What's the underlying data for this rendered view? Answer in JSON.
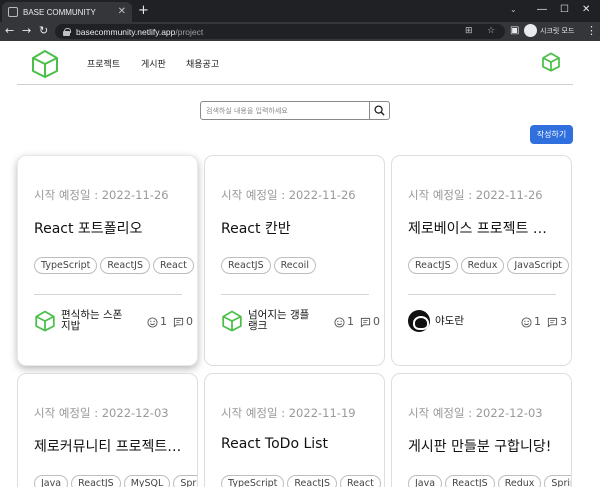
{
  "browser": {
    "tab_title": "BASE COMMUNITY",
    "url_host": "basecommunity.netlify.app",
    "url_path": "/project",
    "profile_label": "시크릿 모드"
  },
  "header": {
    "nav": [
      "프로젝트",
      "게시판",
      "채용공고"
    ]
  },
  "search": {
    "placeholder": "검색하실 내용을 입력하세요"
  },
  "write_button": "작성하기",
  "colors": {
    "accent": "#2f6fde",
    "logo_green": "#4cbf4a"
  },
  "cards": [
    {
      "date": "시작 예정일 : 2022-11-26",
      "title": "React 포트폴리오",
      "tags": [
        "TypeScript",
        "ReactJS",
        "React"
      ],
      "author": "편식하는 스폰지밥",
      "avatar": "cube-icon",
      "likes": "1",
      "comments": "0"
    },
    {
      "date": "시작 예정일 : 2022-11-26",
      "title": "React 칸반",
      "tags": [
        "ReactJS",
        "Recoil"
      ],
      "author": "넘어지는 갱플랭크",
      "avatar": "cube-icon",
      "likes": "1",
      "comments": "0"
    },
    {
      "date": "시작 예정일 : 2022-11-26",
      "title": "제로베이스 프로젝트 같이 하실 분",
      "tags": [
        "ReactJS",
        "Redux",
        "JavaScript"
      ],
      "author": "야도란",
      "avatar": "dark-avatar",
      "likes": "1",
      "comments": "3"
    },
    {
      "date": "시작 예정일 : 2022-12-03",
      "title": "제로커뮤니티 프로젝트 모집합니다",
      "tags": [
        "Java",
        "ReactJS",
        "MySQL",
        "Spring"
      ]
    },
    {
      "date": "시작 예정일 : 2022-11-19",
      "title": "React ToDo List",
      "tags": [
        "TypeScript",
        "ReactJS",
        "React"
      ]
    },
    {
      "date": "시작 예정일 : 2022-12-03",
      "title": "게시판 만들분 구합니당!",
      "tags": [
        "Java",
        "ReactJS",
        "Redux",
        "Spring"
      ]
    }
  ]
}
